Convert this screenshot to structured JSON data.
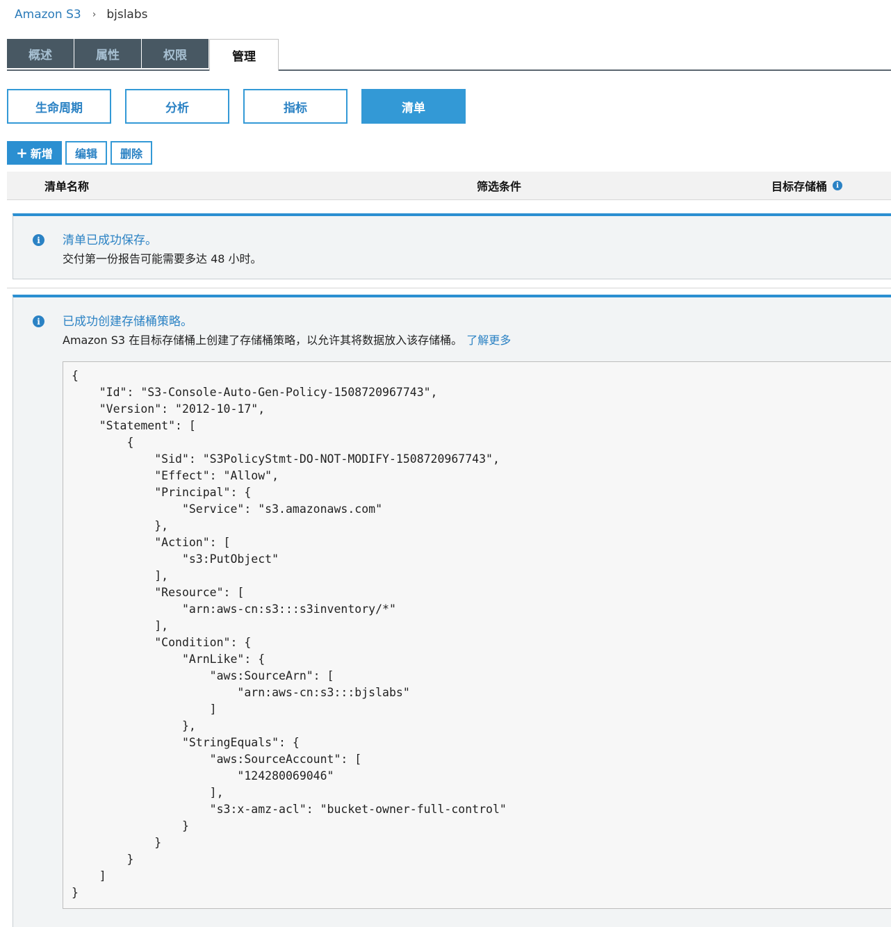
{
  "breadcrumb": {
    "root": "Amazon S3",
    "separator": "›",
    "current": "bjslabs"
  },
  "tabs": [
    {
      "label": "概述",
      "active": false
    },
    {
      "label": "属性",
      "active": false
    },
    {
      "label": "权限",
      "active": false
    },
    {
      "label": "管理",
      "active": true
    }
  ],
  "subtabs": [
    {
      "label": "生命周期",
      "active": false
    },
    {
      "label": "分析",
      "active": false
    },
    {
      "label": "指标",
      "active": false
    },
    {
      "label": "清单",
      "active": true
    }
  ],
  "actions": {
    "add_icon": "+",
    "add_label": "新增",
    "edit_label": "编辑",
    "delete_label": "删除"
  },
  "table": {
    "columns": [
      "清单名称",
      "筛选条件",
      "目标存储桶"
    ]
  },
  "alerts": [
    {
      "title": "清单已成功保存。",
      "body": "交付第一份报告可能需要多达 48 小时。"
    },
    {
      "title": "已成功创建存储桶策略。",
      "body": "Amazon S3 在目标存储桶上创建了存储桶策略，以允许其将数据放入该存储桶。",
      "link": "了解更多",
      "policy_json": "{\n    \"Id\": \"S3-Console-Auto-Gen-Policy-1508720967743\",\n    \"Version\": \"2012-10-17\",\n    \"Statement\": [\n        {\n            \"Sid\": \"S3PolicyStmt-DO-NOT-MODIFY-1508720967743\",\n            \"Effect\": \"Allow\",\n            \"Principal\": {\n                \"Service\": \"s3.amazonaws.com\"\n            },\n            \"Action\": [\n                \"s3:PutObject\"\n            ],\n            \"Resource\": [\n                \"arn:aws-cn:s3:::s3inventory/*\"\n            ],\n            \"Condition\": {\n                \"ArnLike\": {\n                    \"aws:SourceArn\": [\n                        \"arn:aws-cn:s3:::bjslabs\"\n                    ]\n                },\n                \"StringEquals\": {\n                    \"aws:SourceAccount\": [\n                        \"124280069046\"\n                    ],\n                    \"s3:x-amz-acl\": \"bucket-owner-full-control\"\n                }\n            }\n        }\n    ]\n}"
    }
  ],
  "icons": {
    "info": "i"
  },
  "colors": {
    "accent": "#3399d6",
    "tab_bg": "#485863",
    "link": "#2b82c4"
  }
}
